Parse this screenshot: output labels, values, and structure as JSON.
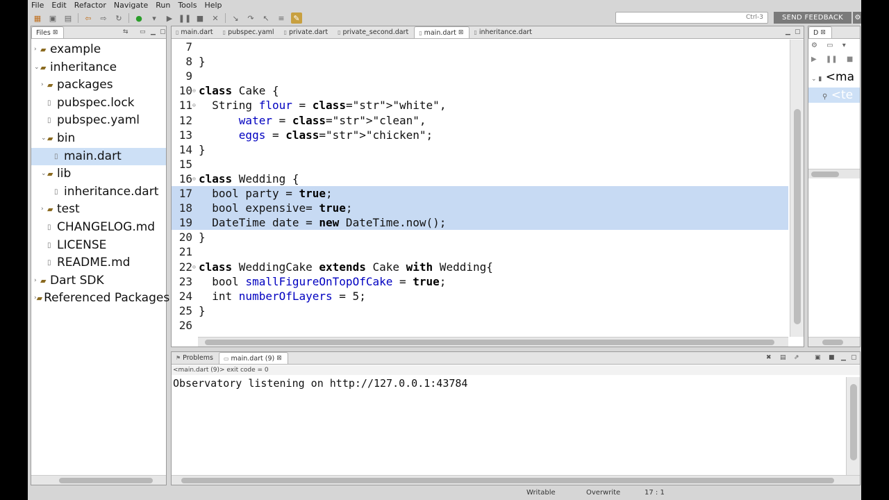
{
  "menu": [
    "File",
    "Edit",
    "Refactor",
    "Navigate",
    "Run",
    "Tools",
    "Help"
  ],
  "search": {
    "shortcut": "Ctrl-3"
  },
  "feedback_label": "SEND FEEDBACK",
  "files_view": {
    "tab_label": "Files",
    "tree": [
      {
        "label": "example",
        "depth": 0,
        "arrow": "›",
        "kind": "folder"
      },
      {
        "label": "inheritance",
        "depth": 0,
        "arrow": "⌄",
        "kind": "folder"
      },
      {
        "label": "packages",
        "depth": 1,
        "arrow": "›",
        "kind": "folder"
      },
      {
        "label": "pubspec.lock",
        "depth": 1,
        "arrow": "",
        "kind": "file"
      },
      {
        "label": "pubspec.yaml",
        "depth": 1,
        "arrow": "",
        "kind": "file"
      },
      {
        "label": "bin",
        "depth": 1,
        "arrow": "⌄",
        "kind": "folder"
      },
      {
        "label": "main.dart",
        "depth": 2,
        "arrow": "",
        "kind": "file",
        "selected": true
      },
      {
        "label": "lib",
        "depth": 1,
        "arrow": "⌄",
        "kind": "folder"
      },
      {
        "label": "inheritance.dart",
        "depth": 2,
        "arrow": "",
        "kind": "file"
      },
      {
        "label": "test",
        "depth": 1,
        "arrow": "›",
        "kind": "folder"
      },
      {
        "label": "CHANGELOG.md",
        "depth": 1,
        "arrow": "",
        "kind": "file"
      },
      {
        "label": "LICENSE",
        "depth": 1,
        "arrow": "",
        "kind": "file"
      },
      {
        "label": "README.md",
        "depth": 1,
        "arrow": "",
        "kind": "file"
      },
      {
        "label": "Dart SDK",
        "depth": 0,
        "arrow": "›",
        "kind": "folder"
      },
      {
        "label": "Referenced Packages",
        "depth": 0,
        "arrow": "›",
        "kind": "folder"
      }
    ]
  },
  "editor": {
    "tabs": [
      {
        "label": "main.dart",
        "active": false
      },
      {
        "label": "pubspec.yaml",
        "active": false
      },
      {
        "label": "private.dart",
        "active": false
      },
      {
        "label": "private_second.dart",
        "active": false
      },
      {
        "label": "main.dart",
        "active": true
      },
      {
        "label": "inheritance.dart",
        "active": false
      }
    ],
    "lines": [
      {
        "n": "7",
        "t": ""
      },
      {
        "n": "8",
        "t": "}"
      },
      {
        "n": "9",
        "t": ""
      },
      {
        "n": "10",
        "t": "class Cake {"
      },
      {
        "n": "11",
        "t": "  String flour = \"white\","
      },
      {
        "n": "12",
        "t": "      water = \"clean\","
      },
      {
        "n": "13",
        "t": "      eggs = \"chicken\";"
      },
      {
        "n": "14",
        "t": "}"
      },
      {
        "n": "15",
        "t": ""
      },
      {
        "n": "16",
        "t": "class Wedding {"
      },
      {
        "n": "17",
        "t": "  bool party = true;"
      },
      {
        "n": "18",
        "t": "  bool expensive= true;"
      },
      {
        "n": "19",
        "t": "  DateTime date = new DateTime.now();"
      },
      {
        "n": "20",
        "t": "}"
      },
      {
        "n": "21",
        "t": ""
      },
      {
        "n": "22",
        "t": "class WeddingCake extends Cake with Wedding{"
      },
      {
        "n": "23",
        "t": "  bool smallFigureOnTopOfCake = true;"
      },
      {
        "n": "24",
        "t": "  int numberOfLayers = 5;"
      },
      {
        "n": "25",
        "t": "}"
      },
      {
        "n": "26",
        "t": ""
      }
    ]
  },
  "outline": {
    "tab_label": "D",
    "item1": "<ma",
    "item2": "<te"
  },
  "console": {
    "tabs": [
      {
        "label": "Problems",
        "active": false
      },
      {
        "label": "main.dart (9)",
        "active": true
      }
    ],
    "subtitle": "<main.dart (9)>  exit code = 0",
    "output": "Observatory listening on http://127.0.0.1:43784"
  },
  "status": {
    "mode": "Writable",
    "insert": "Overwrite",
    "position": "17 : 1"
  }
}
